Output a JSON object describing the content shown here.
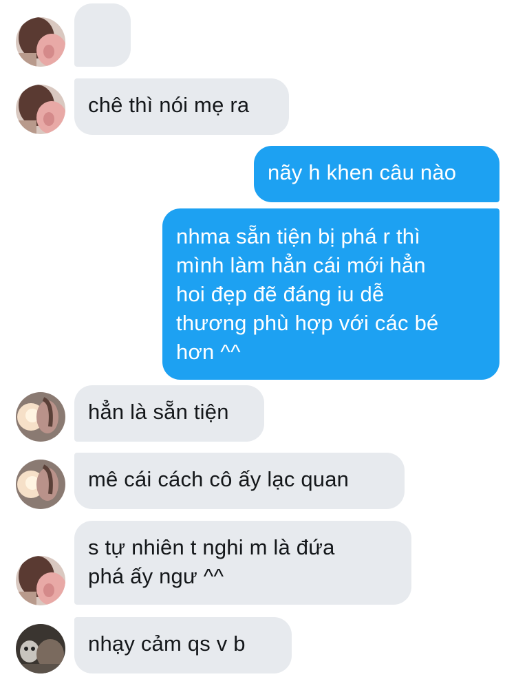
{
  "conversation": {
    "messages": [
      {
        "id": "m1",
        "side": "in",
        "text": "🥰",
        "emoji": "smiling-face-with-hearts-emoji",
        "avatar": "avatar-a"
      },
      {
        "id": "m2",
        "side": "in",
        "text": "chê thì nói mẹ ra",
        "avatar": "avatar-a"
      },
      {
        "id": "m3",
        "side": "out",
        "text": "nãy h khen câu nào"
      },
      {
        "id": "m4",
        "side": "out",
        "text": "nhma sẵn tiện bị phá r thì\nmình làm hẳn cái mới hẳn\nhoi đẹp đẽ đáng iu dễ\nthương phù hợp với các bé\nhơn ^^"
      },
      {
        "id": "m5",
        "side": "in",
        "text": "hẳn là sẵn tiện",
        "avatar": "avatar-b"
      },
      {
        "id": "m6",
        "side": "in",
        "text": "mê cái cách cô ấy lạc quan",
        "avatar": "avatar-b"
      },
      {
        "id": "m7",
        "side": "in",
        "text": "s tự nhiên t nghi m là đứa\nphá ấy ngư ^^",
        "avatar": "avatar-a"
      },
      {
        "id": "m8",
        "side": "in",
        "text": "nhạy cảm qs v b",
        "avatar": "avatar-c"
      }
    ]
  },
  "colors": {
    "incoming_bubble": "#e7eaee",
    "outgoing_bubble": "#1da1f2",
    "incoming_text": "#14171a",
    "outgoing_text": "#ffffff"
  }
}
